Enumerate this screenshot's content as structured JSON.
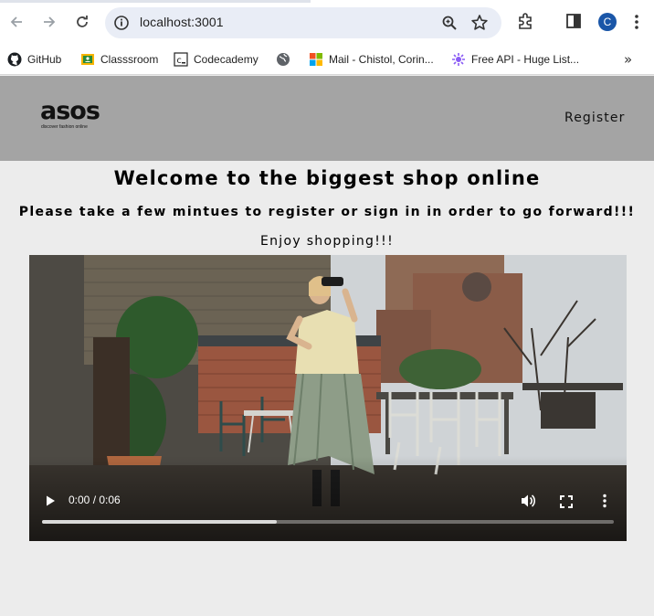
{
  "browser": {
    "url": "localhost:3001",
    "profile_initial": "C",
    "bookmarks": [
      {
        "label": "GitHub",
        "icon": "github-icon"
      },
      {
        "label": "Classsroom",
        "icon": "classroom-icon"
      },
      {
        "label": "Codecademy",
        "icon": "codecademy-icon"
      },
      {
        "label": "",
        "icon": "globe-icon"
      },
      {
        "label": "Mail - Chistol, Corin...",
        "icon": "outlook-mail-icon"
      },
      {
        "label": "Free API - Huge List...",
        "icon": "api-icon"
      }
    ],
    "bookmarks_overflow": "»"
  },
  "header": {
    "logo_text": "asos",
    "logo_tagline": "discover fashion online",
    "register_label": "Register"
  },
  "main": {
    "title": "Welcome to the biggest shop online",
    "subtitle": "Please take a few mintues to register or sign in in order to go forward!!!",
    "tagline": "Enjoy shopping!!!"
  },
  "video": {
    "time_display": "0:00 / 0:06",
    "buffered_fraction": 0.41,
    "colors": {
      "track": "#ffffff",
      "controls": "#ffffff"
    }
  },
  "colors": {
    "header_bg": "#a4a4a4",
    "page_bg": "#ececec",
    "avatar_bg": "#1a56a8"
  }
}
